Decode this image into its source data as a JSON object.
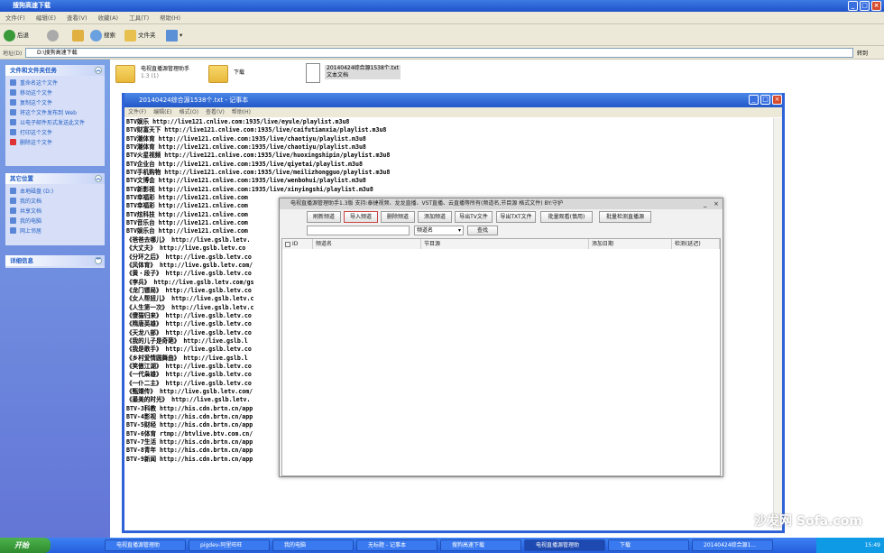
{
  "explorer": {
    "title": "搜狗高速下载",
    "menu": [
      "文件(F)",
      "编辑(E)",
      "查看(V)",
      "收藏(A)",
      "工具(T)",
      "帮助(H)"
    ],
    "toolbar": {
      "back": "后退",
      "search": "搜索",
      "folders": "文件夹"
    },
    "address_label": "地址(D)",
    "address_value": "D:\\搜狗高速下载",
    "go": "转到"
  },
  "taskpane": {
    "file_tasks": {
      "title": "文件和文件夹任务",
      "items": [
        "重命名这个文件",
        "移动这个文件",
        "复制这个文件",
        "将这个文件发布到 Web",
        "以电子邮件形式发送此文件",
        "打印这个文件",
        "删除这个文件"
      ]
    },
    "other_places": {
      "title": "其它位置",
      "items": [
        "本地磁盘 (D:)",
        "我的文档",
        "共享文档",
        "我的电脑",
        "网上邻居"
      ]
    },
    "details": {
      "title": "详细信息"
    }
  },
  "files": [
    {
      "name": "电视直播源管理助手",
      "sub": "1.3 (1)"
    },
    {
      "name": "下载",
      "sub": ""
    },
    {
      "name": "20140424综合源1538个.txt",
      "sub": "文本文档"
    }
  ],
  "notepad": {
    "title": "20140424综合源1538个.txt - 记事本",
    "menu": [
      "文件(F)",
      "编辑(E)",
      "格式(O)",
      "查看(V)",
      "帮助(H)"
    ],
    "lines": [
      "BTV娱乐 http://live121.cnlive.com:1935/live/eyule/playlist.m3u8",
      "BTV财富天下 http://live121.cnlive.com:1935/live/caifutianxia/playlist.m3u8",
      "BTV潮体育 http://live121.cnlive.com:1935/live/chaotiyu/playlist.m3u8",
      "BTV潮体育 http://live121.cnlive.com:1935/live/chaotiyu/playlist.m3u8",
      "BTV火星视频 http://live121.cnlive.com:1935/live/huoxingshipin/playlist.m3u8",
      "BTV企业台 http://live121.cnlive.com:1935/live/qiyetai/playlist.m3u8",
      "BTV手机购物 http://live121.cnlive.com:1935/live/meilizhongguo/playlist.m3u8",
      "BTV文博会 http://live121.cnlive.com:1935/live/wenbohui/playlist.m3u8",
      "BTV新影视 http://live121.cnlive.com:1935/live/xinyingshi/playlist.m3u8",
      "BTV幸福彩 http://live121.cnlive.com",
      "BTV幸福彩 http://live121.cnlive.com",
      "BTV炫科技 http://live121.cnlive.com",
      "BTV音乐台 http://live121.cnlive.com",
      "BTV娱乐台 http://live121.cnlive.com",
      "《爸爸去哪儿》 http://live.gslb.letv.",
      "《大丈夫》 http://live.gslb.letv.co",
      "《分环之后》 http://live.gslb.letv.co",
      "《风体育》 http://live.gslb.letv.com/",
      "《黄・段子》 http://live.gslb.letv.co",
      "《李兵》 http://live.gslb.letv.com/gs",
      "《龙门镖局》 http://live.gslb.letv.co",
      "《女人帮妞儿》 http://live.gslb.letv.c",
      "《人生第一次》 http://live.gslb.letv.c",
      "《傻猫归来》 http://live.gslb.letv.co",
      "《隋唐英雄》 http://live.gslb.letv.co",
      "《天龙八部》 http://live.gslb.letv.co",
      "《我的儿子是奇葩》 http://live.gslb.l",
      "《我是歌手》 http://live.gslb.letv.co",
      "《乡村爱情圆舞曲》 http://live.gslb.l",
      "《笑傲江湖》 http://live.gslb.letv.co",
      "《一代枭雄》 http://live.gslb.letv.co",
      "《一仆二主》 http://live.gslb.letv.co",
      "《甄嬛传》 http://live.gslb.letv.com/",
      "《最美的时光》 http://live.gslb.letv.",
      "BTV-3科教 http://his.cdn.brtn.cn/app",
      "BTV-4影视 http://his.cdn.brtn.cn/app",
      "BTV-5财经 http://his.cdn.brtn.cn/app",
      "BTV-6体育 rtmp://btvlive.btv.com.cn/",
      "BTV-7生活 http://his.cdn.brtn.cn/app",
      "BTV-8青年 http://his.cdn.brtn.cn/app",
      "BTV-9新闻 http://his.cdn.brtn.cn/app"
    ]
  },
  "dialog": {
    "title": "电视直播源管理助手1.3版  支持:泰捷视频、龙龙直播、VST直播、云直播等所有(频道名,节目源  格式文件) BY:守护",
    "buttons": [
      "刷新频道",
      "导入频道",
      "删除频道",
      "添加频道",
      "导出TV文件",
      "导出TXT文件",
      "批量观看(慎用)",
      "批量检测直播源"
    ],
    "search_placeholder": "",
    "select_value": "频道名",
    "search_button": "查找",
    "columns": [
      "ID",
      "频道名",
      "节目源",
      "添加日期",
      "检测(延迟)"
    ]
  },
  "taskbar": {
    "start": "开始",
    "tasks": [
      "电视直播源管理助",
      "pigdev-阿里旺旺",
      "我的电脑",
      "无标题 - 记事本",
      "搜狗高速下载",
      "电视直播源管理助",
      "下载",
      "20140424综合源1..."
    ],
    "clock": "15:49"
  },
  "watermark": "沙发网 Sofa.com"
}
